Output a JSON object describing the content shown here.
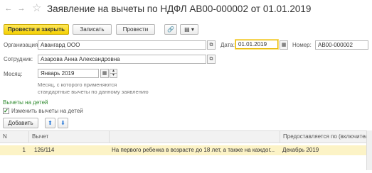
{
  "window": {
    "back_glyph": "←",
    "forward_glyph": "→",
    "star_glyph": "☆",
    "title": "Заявление на вычеты по НДФЛ АВ00-000002 от 01.01.2019"
  },
  "toolbar": {
    "post_close_label": "Провести и закрыть",
    "save_label": "Записать",
    "post_label": "Провести",
    "attach_glyph": "🔗",
    "print_glyph": "▤ ▾"
  },
  "form": {
    "organization": {
      "label": "Организация:",
      "value": "Авангард ООО",
      "open_glyph": "⧉"
    },
    "date": {
      "label": "Дата:",
      "value": "01.01.2019",
      "calendar_glyph": "▦"
    },
    "number": {
      "label": "Номер:",
      "value": "АВ00-000002"
    },
    "employee": {
      "label": "Сотрудник:",
      "value": "Азарова Анна Александровна",
      "open_glyph": "⧉"
    },
    "month": {
      "label": "Месяц:",
      "value": "Январь 2019",
      "calendar_glyph": "▦",
      "up_glyph": "▴",
      "down_glyph": "▾",
      "hint_line1": "Месяц, с которого применяются",
      "hint_line2": "стандартные вычеты по данному заявлению"
    }
  },
  "children_section": {
    "title": "Вычеты на детей",
    "change_checkbox_label": "Изменить вычеты на детей",
    "change_checked": true,
    "check_glyph": "✓",
    "add_label": "Добавить",
    "up_glyph": "⬆",
    "down_glyph": "⬇"
  },
  "table": {
    "columns": [
      "N",
      "Вычет",
      "",
      "Предоставляется по (включительно)"
    ],
    "rows": [
      {
        "n": "1",
        "code": "126/114",
        "description": "На первого ребенка в возрасте до 18 лет, а также на каждог...",
        "until": "Декабрь 2019"
      }
    ]
  },
  "colors": {
    "primary_button": "#f4d000",
    "selected_row": "#fcf3c6",
    "focus_border": "#e8b800",
    "section_link": "#2f8a2f"
  }
}
